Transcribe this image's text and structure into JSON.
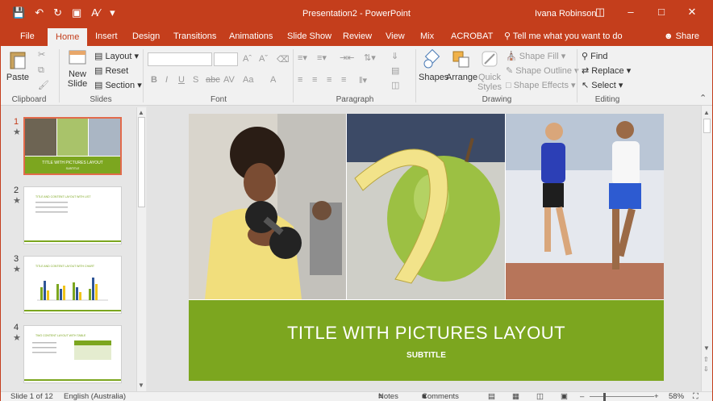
{
  "titlebar": {
    "document_title": "Presentation2 - PowerPoint",
    "user": "Ivana Robinson"
  },
  "tabs": [
    "File",
    "Home",
    "Insert",
    "Design",
    "Transitions",
    "Animations",
    "Slide Show",
    "Review",
    "View",
    "Mix",
    "ACROBAT"
  ],
  "tell_me": "Tell me what you want to do",
  "share": "Share",
  "ribbon": {
    "clipboard": {
      "label": "Clipboard",
      "paste": "Paste"
    },
    "slides": {
      "label": "Slides",
      "new_slide_1": "New",
      "new_slide_2": "Slide",
      "layout": "Layout",
      "reset": "Reset",
      "section": "Section"
    },
    "font": {
      "label": "Font",
      "bold": "B",
      "italic": "I",
      "underline": "U",
      "shadow": "S",
      "strike": "abc",
      "spacing": "AV",
      "case": "Aa",
      "color": "A"
    },
    "paragraph": {
      "label": "Paragraph"
    },
    "drawing": {
      "label": "Drawing",
      "shapes": "Shapes",
      "arrange": "Arrange",
      "quick_1": "Quick",
      "quick_2": "Styles",
      "fill": "Shape Fill",
      "outline": "Shape Outline",
      "effects": "Shape Effects"
    },
    "editing": {
      "label": "Editing",
      "find": "Find",
      "replace": "Replace",
      "select": "Select"
    }
  },
  "thumbnails": [
    {
      "num": "1",
      "title": "TITLE WITH PICTURES LAYOUT",
      "sub": "SUBTITLE"
    },
    {
      "num": "2",
      "title": "TITLE AND CONTENT LAYOUT WITH LIST"
    },
    {
      "num": "3",
      "title": "TITLE AND CONTENT LAYOUT WITH CHART"
    },
    {
      "num": "4",
      "title": "TWO CONTENT LAYOUT WITH TABLE"
    }
  ],
  "slide": {
    "title": "TITLE WITH PICTURES LAYOUT",
    "subtitle": "SUBTITLE"
  },
  "status": {
    "slide": "Slide 1 of 12",
    "language": "English (Australia)",
    "notes": "Notes",
    "comments": "Comments",
    "zoom": "58%"
  },
  "colors": {
    "accent": "#c43e1c",
    "slide_green": "#7ca61f"
  }
}
